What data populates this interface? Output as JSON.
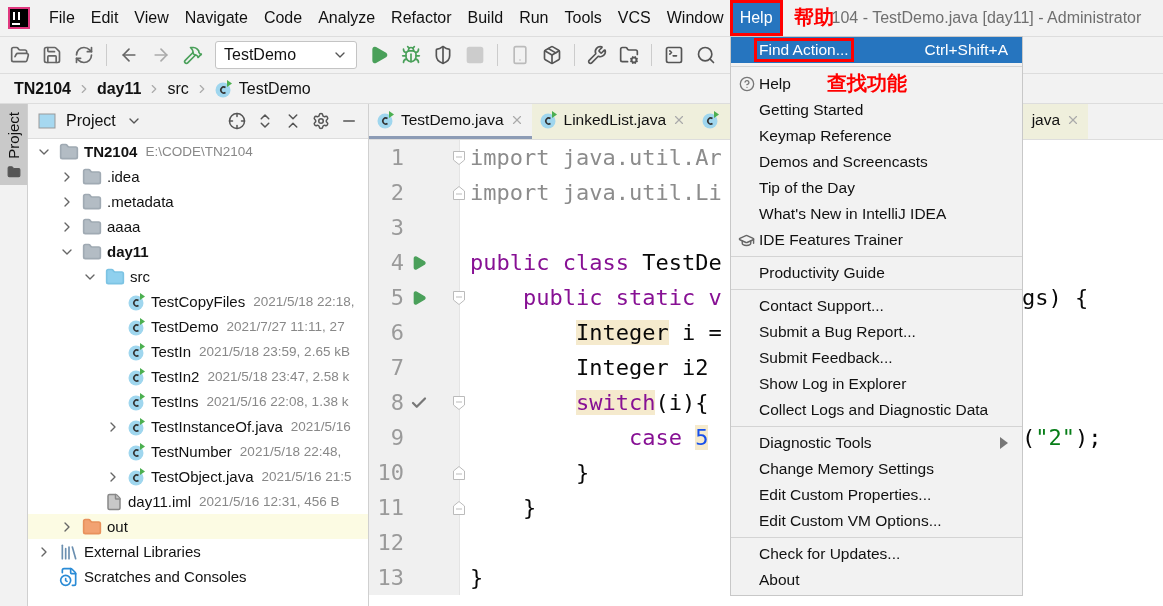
{
  "window": {
    "title": "104 - TestDemo.java [day11] - Administrator"
  },
  "menubar": [
    {
      "label": "File",
      "selected": false,
      "outlined": false
    },
    {
      "label": "Edit",
      "selected": false,
      "outlined": false
    },
    {
      "label": "View",
      "selected": false,
      "outlined": false
    },
    {
      "label": "Navigate",
      "selected": false,
      "outlined": false
    },
    {
      "label": "Code",
      "selected": false,
      "outlined": false
    },
    {
      "label": "Analyze",
      "selected": false,
      "outlined": false
    },
    {
      "label": "Refactor",
      "selected": false,
      "outlined": false
    },
    {
      "label": "Build",
      "selected": false,
      "outlined": false
    },
    {
      "label": "Run",
      "selected": false,
      "outlined": false
    },
    {
      "label": "Tools",
      "selected": false,
      "outlined": false
    },
    {
      "label": "VCS",
      "selected": false,
      "outlined": false
    },
    {
      "label": "Window",
      "selected": false,
      "outlined": false
    },
    {
      "label": "Help",
      "selected": true,
      "outlined": true
    }
  ],
  "toolbar": {
    "run_config": "TestDemo"
  },
  "breadcrumbs": [
    {
      "label": "TN2104",
      "kind": "module"
    },
    {
      "label": "day11",
      "kind": "module"
    },
    {
      "label": "src",
      "kind": "folder"
    },
    {
      "label": "TestDemo",
      "kind": "class"
    }
  ],
  "side_tab": {
    "label": "Project"
  },
  "project": {
    "title": "Project",
    "tree": [
      {
        "label": "TN2104",
        "detail": "E:\\CODE\\TN2104",
        "kind": "module",
        "expanded": true,
        "children": [
          {
            "label": ".idea",
            "kind": "folder",
            "expanded": false
          },
          {
            "label": ".metadata",
            "kind": "folder",
            "expanded": false
          },
          {
            "label": "aaaa",
            "kind": "folder",
            "expanded": false
          },
          {
            "label": "day11",
            "kind": "module",
            "expanded": true,
            "children": [
              {
                "label": "src",
                "kind": "source",
                "expanded": true,
                "children": [
                  {
                    "label": "TestCopyFiles",
                    "detail": "2021/5/18 22:18,",
                    "kind": "class"
                  },
                  {
                    "label": "TestDemo",
                    "detail": "2021/7/27 11:11, 27",
                    "kind": "class"
                  },
                  {
                    "label": "TestIn",
                    "detail": "2021/5/18 23:59, 2.65 kB",
                    "kind": "class"
                  },
                  {
                    "label": "TestIn2",
                    "detail": "2021/5/18 23:47, 2.58 k",
                    "kind": "class"
                  },
                  {
                    "label": "TestIns",
                    "detail": "2021/5/16 22:08, 1.38 k",
                    "kind": "class"
                  },
                  {
                    "label": "TestInstanceOf.java",
                    "detail": "2021/5/16",
                    "kind": "class",
                    "expanded": false
                  },
                  {
                    "label": "TestNumber",
                    "detail": "2021/5/18 22:48,",
                    "kind": "class"
                  },
                  {
                    "label": "TestObject.java",
                    "detail": "2021/5/16 21:5",
                    "kind": "class",
                    "expanded": false
                  }
                ]
              },
              {
                "label": "day11.iml",
                "detail": "2021/5/16 12:31, 456 B",
                "kind": "file"
              }
            ]
          },
          {
            "label": "out",
            "kind": "excluded",
            "expanded": false
          }
        ]
      },
      {
        "label": "External Libraries",
        "kind": "libraries",
        "expanded": false
      },
      {
        "label": "Scratches and Consoles",
        "kind": "scratches"
      }
    ]
  },
  "editor": {
    "tabs": [
      {
        "label": "TestDemo.java",
        "selected": true
      },
      {
        "label": "LinkedList.java",
        "selected": false
      },
      {
        "label": "java",
        "selected": false
      }
    ],
    "lines": [
      {
        "number": "1",
        "fold_start": true,
        "tokens": [
          {
            "text": "import java.util.Ar",
            "kind": "unused"
          }
        ]
      },
      {
        "number": "2",
        "fold_end": true,
        "tokens": [
          {
            "text": "import java.util.Li",
            "kind": "unused"
          }
        ]
      },
      {
        "number": "3"
      },
      {
        "number": "4",
        "runnable": true,
        "tokens": [
          {
            "text": "public class ",
            "kind": "keyword"
          },
          {
            "text": "TestDe",
            "kind": "plain"
          }
        ]
      },
      {
        "number": "5",
        "runnable": true,
        "fold_start": true,
        "tokens": [
          {
            "text": "    public static v",
            "kind": "keyword"
          }
        ],
        "tail": [
          {
            "text": "gs) {",
            "kind": "plain"
          }
        ]
      },
      {
        "number": "6",
        "tokens": [
          {
            "text": "        Integer",
            "kind": "plain",
            "marked": true
          },
          {
            "text": " i =",
            "kind": "plain"
          }
        ]
      },
      {
        "number": "7",
        "tokens": [
          {
            "text": "        Integer i2",
            "kind": "plain"
          }
        ]
      },
      {
        "number": "8",
        "checked": true,
        "fold_start": true,
        "tokens": [
          {
            "text": "        switch",
            "kind": "keyword",
            "marked": true
          },
          {
            "text": "(i){",
            "kind": "plain"
          }
        ]
      },
      {
        "number": "9",
        "tokens": [
          {
            "text": "            case ",
            "kind": "keyword"
          },
          {
            "text": "5",
            "kind": "number",
            "marked": true
          }
        ],
        "tail": [
          {
            "text": "(",
            "kind": "plain"
          },
          {
            "text": "\"2\"",
            "kind": "string"
          },
          {
            "text": ");",
            "kind": "plain"
          }
        ]
      },
      {
        "number": "10",
        "fold_end": true,
        "tokens": [
          {
            "text": "        }",
            "kind": "plain"
          }
        ]
      },
      {
        "number": "11",
        "fold_end": true,
        "tokens": [
          {
            "text": "    }",
            "kind": "plain"
          }
        ]
      },
      {
        "number": "12"
      },
      {
        "number": "13",
        "tokens": [
          {
            "text": "}",
            "kind": "plain"
          }
        ]
      }
    ]
  },
  "help_menu": {
    "groups": [
      [
        {
          "label": "Find Action...",
          "kind": "plain",
          "shortcut": "Ctrl+Shift+A",
          "selected": true,
          "outlined": true
        }
      ],
      [
        {
          "label": "Help",
          "kind": "help",
          "note": "查找功能",
          "selected": false
        },
        {
          "label": "Getting Started",
          "kind": "plain",
          "selected": false
        },
        {
          "label": "Keymap Reference",
          "kind": "plain",
          "selected": false
        },
        {
          "label": "Demos and Screencasts",
          "kind": "plain",
          "selected": false
        },
        {
          "label": "Tip of the Day",
          "kind": "plain",
          "selected": false
        },
        {
          "label": "What's New in IntelliJ IDEA",
          "kind": "plain",
          "selected": false
        },
        {
          "label": "IDE Features Trainer",
          "kind": "trainer",
          "selected": false
        }
      ],
      [
        {
          "label": "Productivity Guide",
          "kind": "plain",
          "selected": false
        }
      ],
      [
        {
          "label": "Contact Support...",
          "kind": "plain",
          "selected": false
        },
        {
          "label": "Submit a Bug Report...",
          "kind": "plain",
          "selected": false
        },
        {
          "label": "Submit Feedback...",
          "kind": "plain",
          "selected": false
        },
        {
          "label": "Show Log in Explorer",
          "kind": "plain",
          "selected": false
        },
        {
          "label": "Collect Logs and Diagnostic Data",
          "kind": "plain",
          "selected": false
        }
      ],
      [
        {
          "label": "Diagnostic Tools",
          "kind": "plain",
          "submenu": true,
          "selected": false
        },
        {
          "label": "Change Memory Settings",
          "kind": "plain",
          "selected": false
        },
        {
          "label": "Edit Custom Properties...",
          "kind": "plain",
          "selected": false
        },
        {
          "label": "Edit Custom VM Options...",
          "kind": "plain",
          "selected": false
        }
      ],
      [
        {
          "label": "Check for Updates...",
          "kind": "plain",
          "selected": false
        },
        {
          "label": "About",
          "kind": "plain",
          "selected": false
        }
      ]
    ]
  },
  "annotations": [
    {
      "text": "帮助",
      "kind": "menu"
    }
  ]
}
